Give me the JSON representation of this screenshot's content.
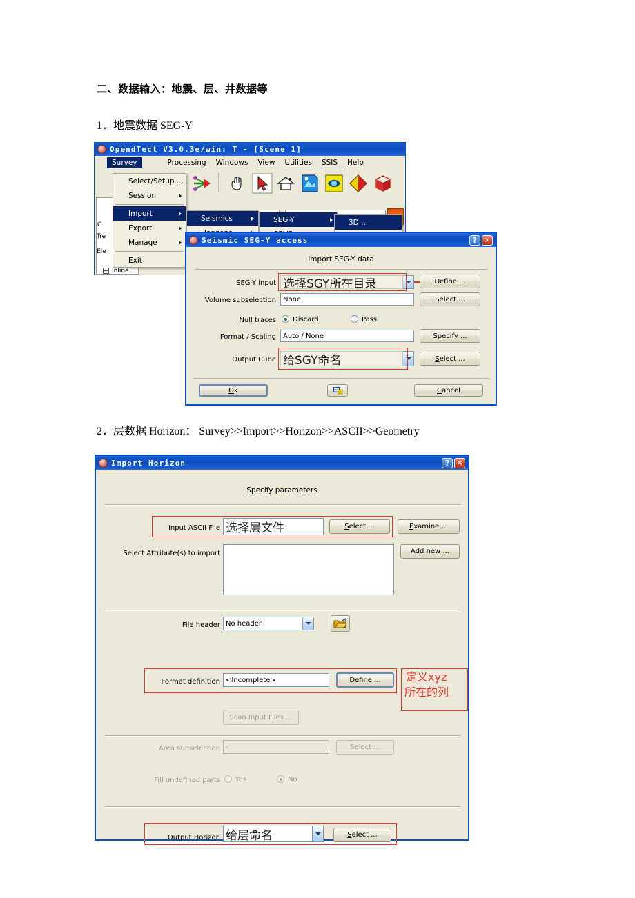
{
  "document": {
    "heading": "二、数据输入：地震、层、井数据等",
    "item1": "1．地震数据 SEG-Y",
    "item2": "2．层数据 Horizon： Survey>>Import>>Horizon>>ASCII>>Geometry"
  },
  "opendtect": {
    "title": "OpendTect V3.0.3e/win: T - [Scene 1]",
    "menubar": [
      {
        "label": "Survey",
        "selected": true
      },
      {
        "label": "Processing",
        "selected": false
      },
      {
        "label": "Windows",
        "selected": false
      },
      {
        "label": "View",
        "selected": false
      },
      {
        "label": "Utilities",
        "selected": false
      },
      {
        "label": "SSIS",
        "selected": false
      },
      {
        "label": "Help",
        "selected": false
      }
    ],
    "tree": {
      "label_tre": "Tre",
      "label_c": "C",
      "label_ele": "Ele",
      "label_inline": "Inline"
    },
    "survey_menu": [
      {
        "label": "Select/Setup ...",
        "submenu": false,
        "highlight": false
      },
      {
        "label": "Session",
        "submenu": true,
        "highlight": false
      },
      {
        "label": "Import",
        "submenu": true,
        "highlight": true
      },
      {
        "label": "Export",
        "submenu": true,
        "highlight": false
      },
      {
        "label": "Manage",
        "submenu": true,
        "highlight": false
      },
      {
        "label": "Exit",
        "submenu": false,
        "highlight": false
      }
    ],
    "import_menu": [
      {
        "label": "Seismics",
        "submenu": true,
        "highlight": true
      },
      {
        "label": "Horizons",
        "submenu": true,
        "highlight": false
      }
    ],
    "seismics_menu": [
      {
        "label": "SEG-Y",
        "submenu": true,
        "highlight": true
      },
      {
        "label": "CBVS",
        "submenu": false,
        "highlight": false
      }
    ],
    "segy_menu": [
      {
        "label": "3D ...",
        "submenu": false,
        "highlight": true
      }
    ]
  },
  "segy_dialog": {
    "title": "Seismic SEG-Y access",
    "caption": "Import SEG-Y data",
    "help_btn": "?",
    "close_btn": "✕",
    "fields": {
      "segy_input_label": "SEG-Y input",
      "segy_input_value": "选择SGY所在目录",
      "segy_input_button": "Define ...",
      "volume_label": "Volume subselection",
      "volume_value": "None",
      "volume_button": "Select ...",
      "null_traces_label": "Null traces",
      "null_traces_opt1": "Discard",
      "null_traces_opt2": "Pass",
      "null_traces_selected": "Discard",
      "format_label": "Format / Scaling",
      "format_value": "Auto / None",
      "format_button": "Specify ...",
      "output_label": "Output Cube",
      "output_value": "给SGY命名",
      "output_button": "Select ..."
    },
    "buttons": {
      "ok": "Ok",
      "cancel": "Cancel"
    }
  },
  "horizon_dialog": {
    "title": "Import Horizon",
    "caption": "Specify parameters",
    "help_btn": "?",
    "close_btn": "✕",
    "fields": {
      "input_ascii_label": "Input ASCII File",
      "input_ascii_value": "选择层文件",
      "input_ascii_select": "Select ...",
      "input_ascii_examine": "Examine ...",
      "attributes_label": "Select Attribute(s) to import",
      "attributes_value": "",
      "attributes_button": "Add new ...",
      "file_header_label": "File header",
      "file_header_value": "No header",
      "format_def_label": "Format definition",
      "format_def_value": "<Incomplete>",
      "format_def_button": "Define ...",
      "scan_button": "Scan Input Files ...",
      "area_label": "Area subselection",
      "area_value": "-",
      "area_button": "Select ...",
      "fill_label": "Fill undefined parts",
      "fill_opt1": "Yes",
      "fill_opt2": "No",
      "fill_selected": "No",
      "output_horizon_label": "Output Horizon",
      "output_horizon_value": "给层命名",
      "output_horizon_button": "Select ..."
    },
    "annotation": {
      "line1": "定义xyz",
      "line2": "所在的列"
    }
  },
  "colors": {
    "title_blue": "#0a4ec4",
    "dialog_face": "#ece9d8",
    "menu_highlight": "#0a246a",
    "annotation_red": "#e8342c"
  }
}
